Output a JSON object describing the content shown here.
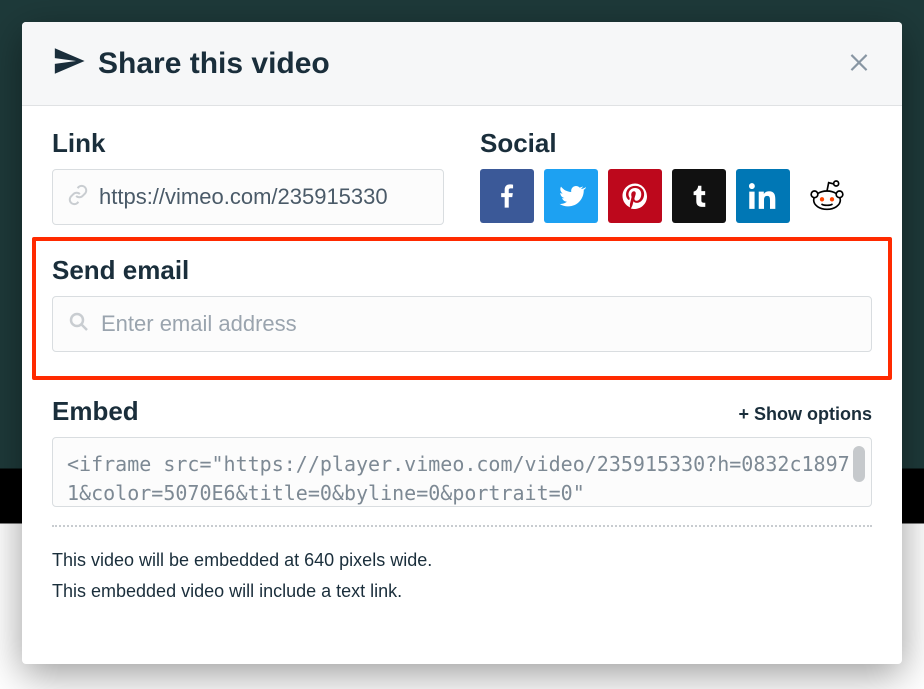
{
  "header": {
    "title": "Share this video"
  },
  "link": {
    "label": "Link",
    "value": "https://vimeo.com/235915330"
  },
  "social": {
    "label": "Social",
    "facebook": "facebook",
    "twitter": "twitter",
    "pinterest": "pinterest",
    "tumblr": "tumblr",
    "linkedin": "linkedin",
    "reddit": "reddit"
  },
  "email": {
    "label": "Send email",
    "placeholder": "Enter email address"
  },
  "embed": {
    "label": "Embed",
    "show_options": "+ Show options",
    "code": "<iframe src=\"https://player.vimeo.com/video/235915330?h=0832c18971&color=5070E6&title=0&byline=0&portrait=0\""
  },
  "footer": {
    "line1": "This video will be embedded at 640 pixels wide.",
    "line2": "This embedded video will include a text link."
  }
}
